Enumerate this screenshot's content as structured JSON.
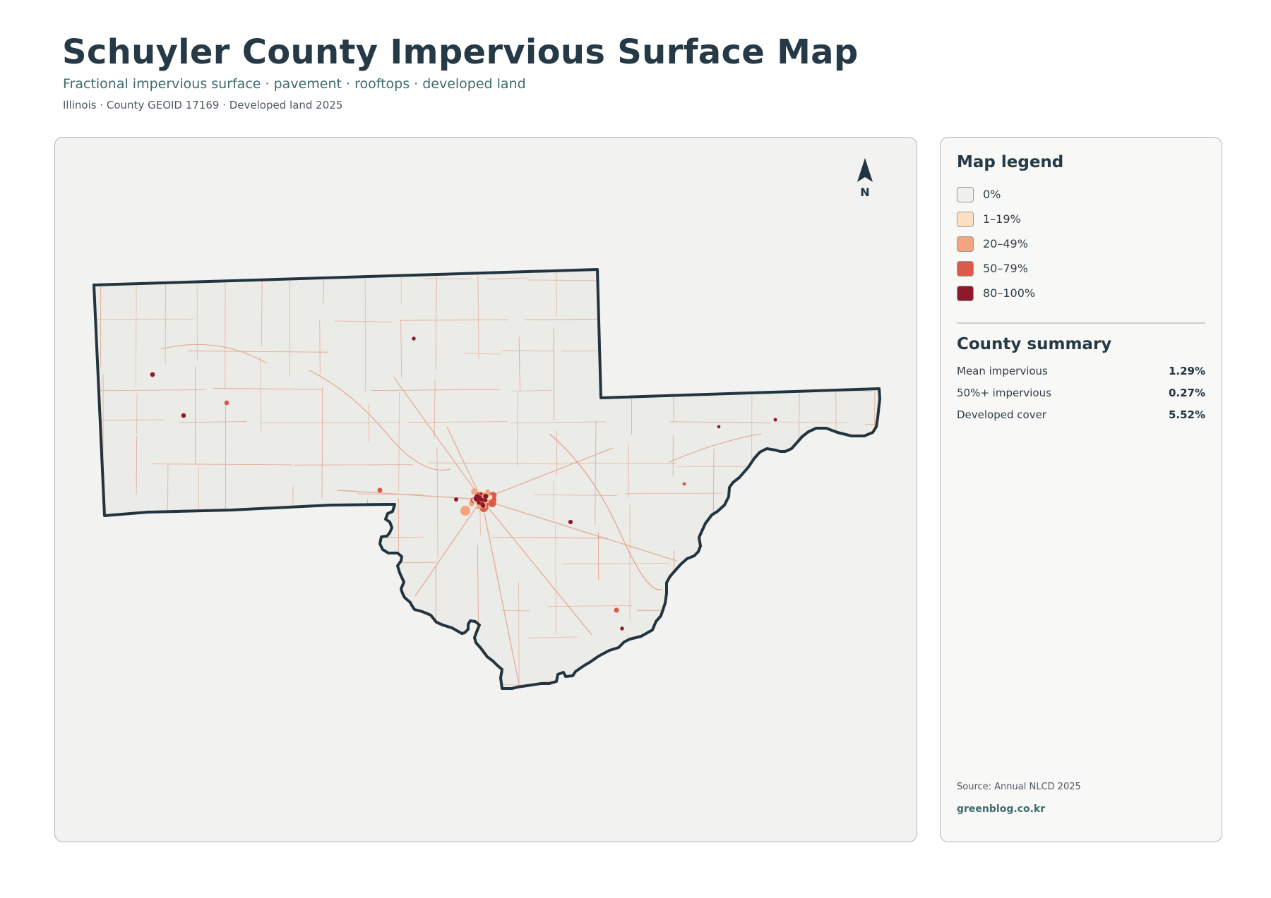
{
  "header": {
    "title": "Schuyler County Impervious Surface Map",
    "subtitle": "Fractional impervious surface · pavement · rooftops · developed land",
    "meta": "Illinois · County GEOID 17169 · Developed land 2025"
  },
  "map": {
    "north_label": "N",
    "land_color": "#ebebe7",
    "boundary_color": "#22343f",
    "road_color": "#e08a6a"
  },
  "legend": {
    "title": "Map legend",
    "items": [
      {
        "label": "0%",
        "color": "#f0f0ee"
      },
      {
        "label": "1–19%",
        "color": "#fde0c1"
      },
      {
        "label": "20–49%",
        "color": "#f4a57e"
      },
      {
        "label": "50–79%",
        "color": "#db5b49"
      },
      {
        "label": "80–100%",
        "color": "#8c1a2c"
      }
    ]
  },
  "summary": {
    "title": "County summary",
    "stats": [
      {
        "label": "Mean impervious",
        "value": "1.29%"
      },
      {
        "label": "50%+ impervious",
        "value": "0.27%"
      },
      {
        "label": "Developed cover",
        "value": "5.52%"
      }
    ]
  },
  "footer": {
    "source": "Source: Annual NLCD 2025",
    "site": "greenblog.co.kr"
  }
}
